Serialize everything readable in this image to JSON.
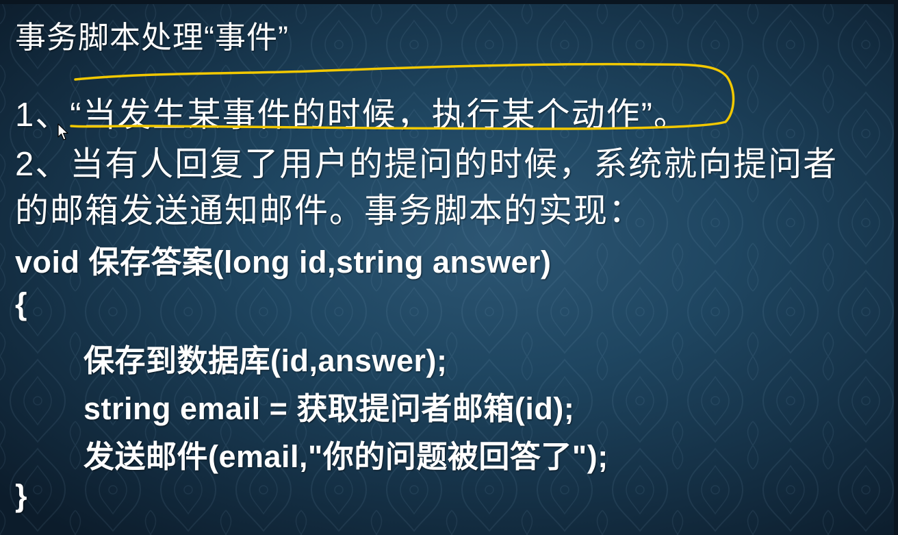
{
  "slide": {
    "title": "事务脚本处理“事件”",
    "lines": [
      "1、“当发生某事件的时候，执行某个动作”。",
      "2、当有人回复了用户的提问的时候，系统就向提问者",
      "的邮箱发送通知邮件。事务脚本的实现："
    ],
    "code": [
      "void 保存答案(long id,string answer)",
      "{",
      "保存到数据库(id,answer);",
      "string email = 获取提问者邮箱(id);",
      "发送邮件(email,\"你的问题被回答了\");",
      "}"
    ]
  },
  "colors": {
    "background": "#1f4661",
    "text": "#ffffff",
    "highlight": "#f2c800"
  }
}
